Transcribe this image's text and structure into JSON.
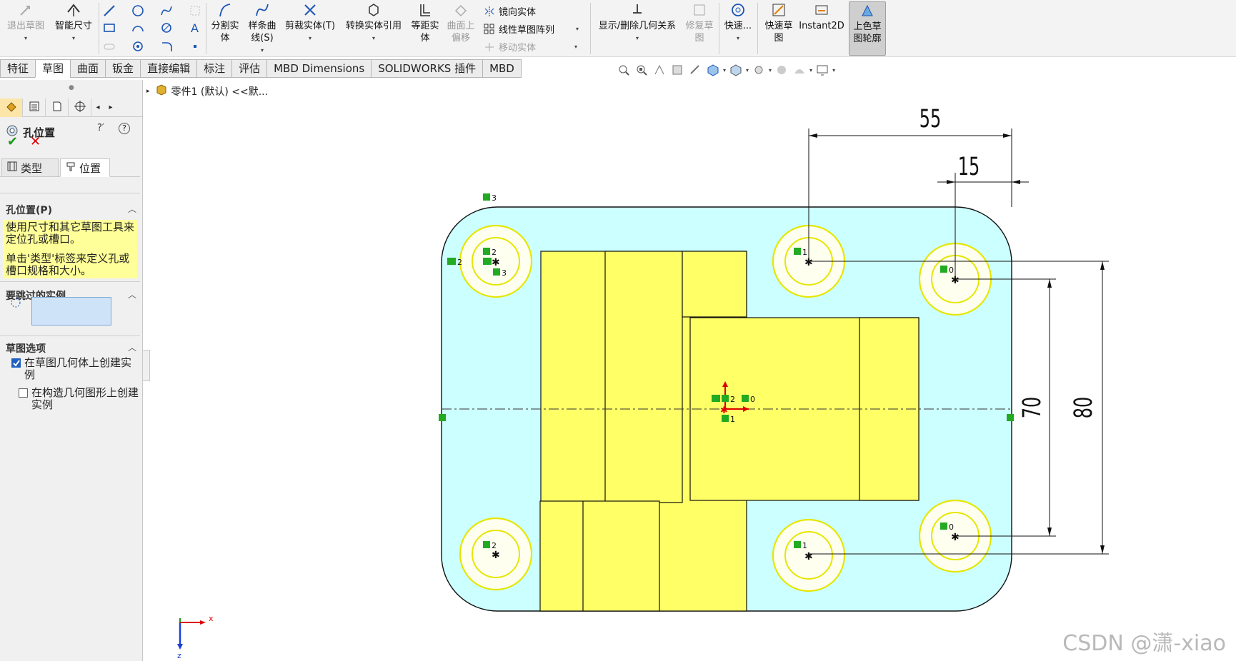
{
  "ribbon": {
    "exit_sketch": "退出草图",
    "smart_dim": "智能尺寸",
    "split_entity": [
      "分割实",
      "体"
    ],
    "spline": [
      "样条曲",
      "线(S)"
    ],
    "trim": "剪裁实体(T)",
    "convert": "转换实体引用",
    "offset": [
      "等距实",
      "体"
    ],
    "surface_offset": [
      "曲面上",
      "偏移"
    ],
    "mirror": "镜向实体",
    "linear_pattern": "线性草图阵列",
    "move": "移动实体",
    "relations": "显示/删除几何关系",
    "repair": [
      "修复草",
      "图"
    ],
    "quick_snaps": "快速...",
    "rapid_sketch": [
      "快速草",
      "图"
    ],
    "instant2d": "Instant2D",
    "shaded_sketch": [
      "上色草",
      "图轮廓"
    ]
  },
  "tabs": [
    "特征",
    "草图",
    "曲面",
    "钣金",
    "直接编辑",
    "标注",
    "评估",
    "MBD Dimensions",
    "SOLIDWORKS 插件",
    "MBD"
  ],
  "active_tab": "草图",
  "tree_label": "零件1 (默认) <<默...",
  "panel": {
    "title": "孔位置",
    "subtab_type": "类型",
    "subtab_position": "位置",
    "section_position": "孔位置(P)",
    "message_line1": "使用尺寸和其它草图工具来定位孔或槽口。",
    "message_line2": "单击'类型'标签来定义孔或槽口规格和大小。",
    "section_skip": "要跳过的实例",
    "section_options": "草图选项",
    "opt_geom": "在草图几何体上创建实例",
    "opt_geom_checked": true,
    "opt_constr": "在构造几何图形上创建实例",
    "opt_constr_checked": false
  },
  "dimensions": {
    "d55": "55",
    "d15": "15",
    "d70": "70",
    "d80": "80"
  },
  "relation_tags": {
    "r3a": "3",
    "r2a": "2",
    "r2b": "2",
    "r3b": "3",
    "r1a": "1",
    "r0a": "0",
    "r2c": "2",
    "r0b": "0",
    "r1b": "1",
    "r2d": "2",
    "r1c": "1",
    "r0c": "0"
  },
  "axis": {
    "x": "x",
    "z": "z"
  },
  "watermark": "CSDN @潇-xiao",
  "colors": {
    "face": "#ccffff",
    "body": "#ffff66",
    "circle": "#e6e600",
    "relation": "#22aa22"
  }
}
